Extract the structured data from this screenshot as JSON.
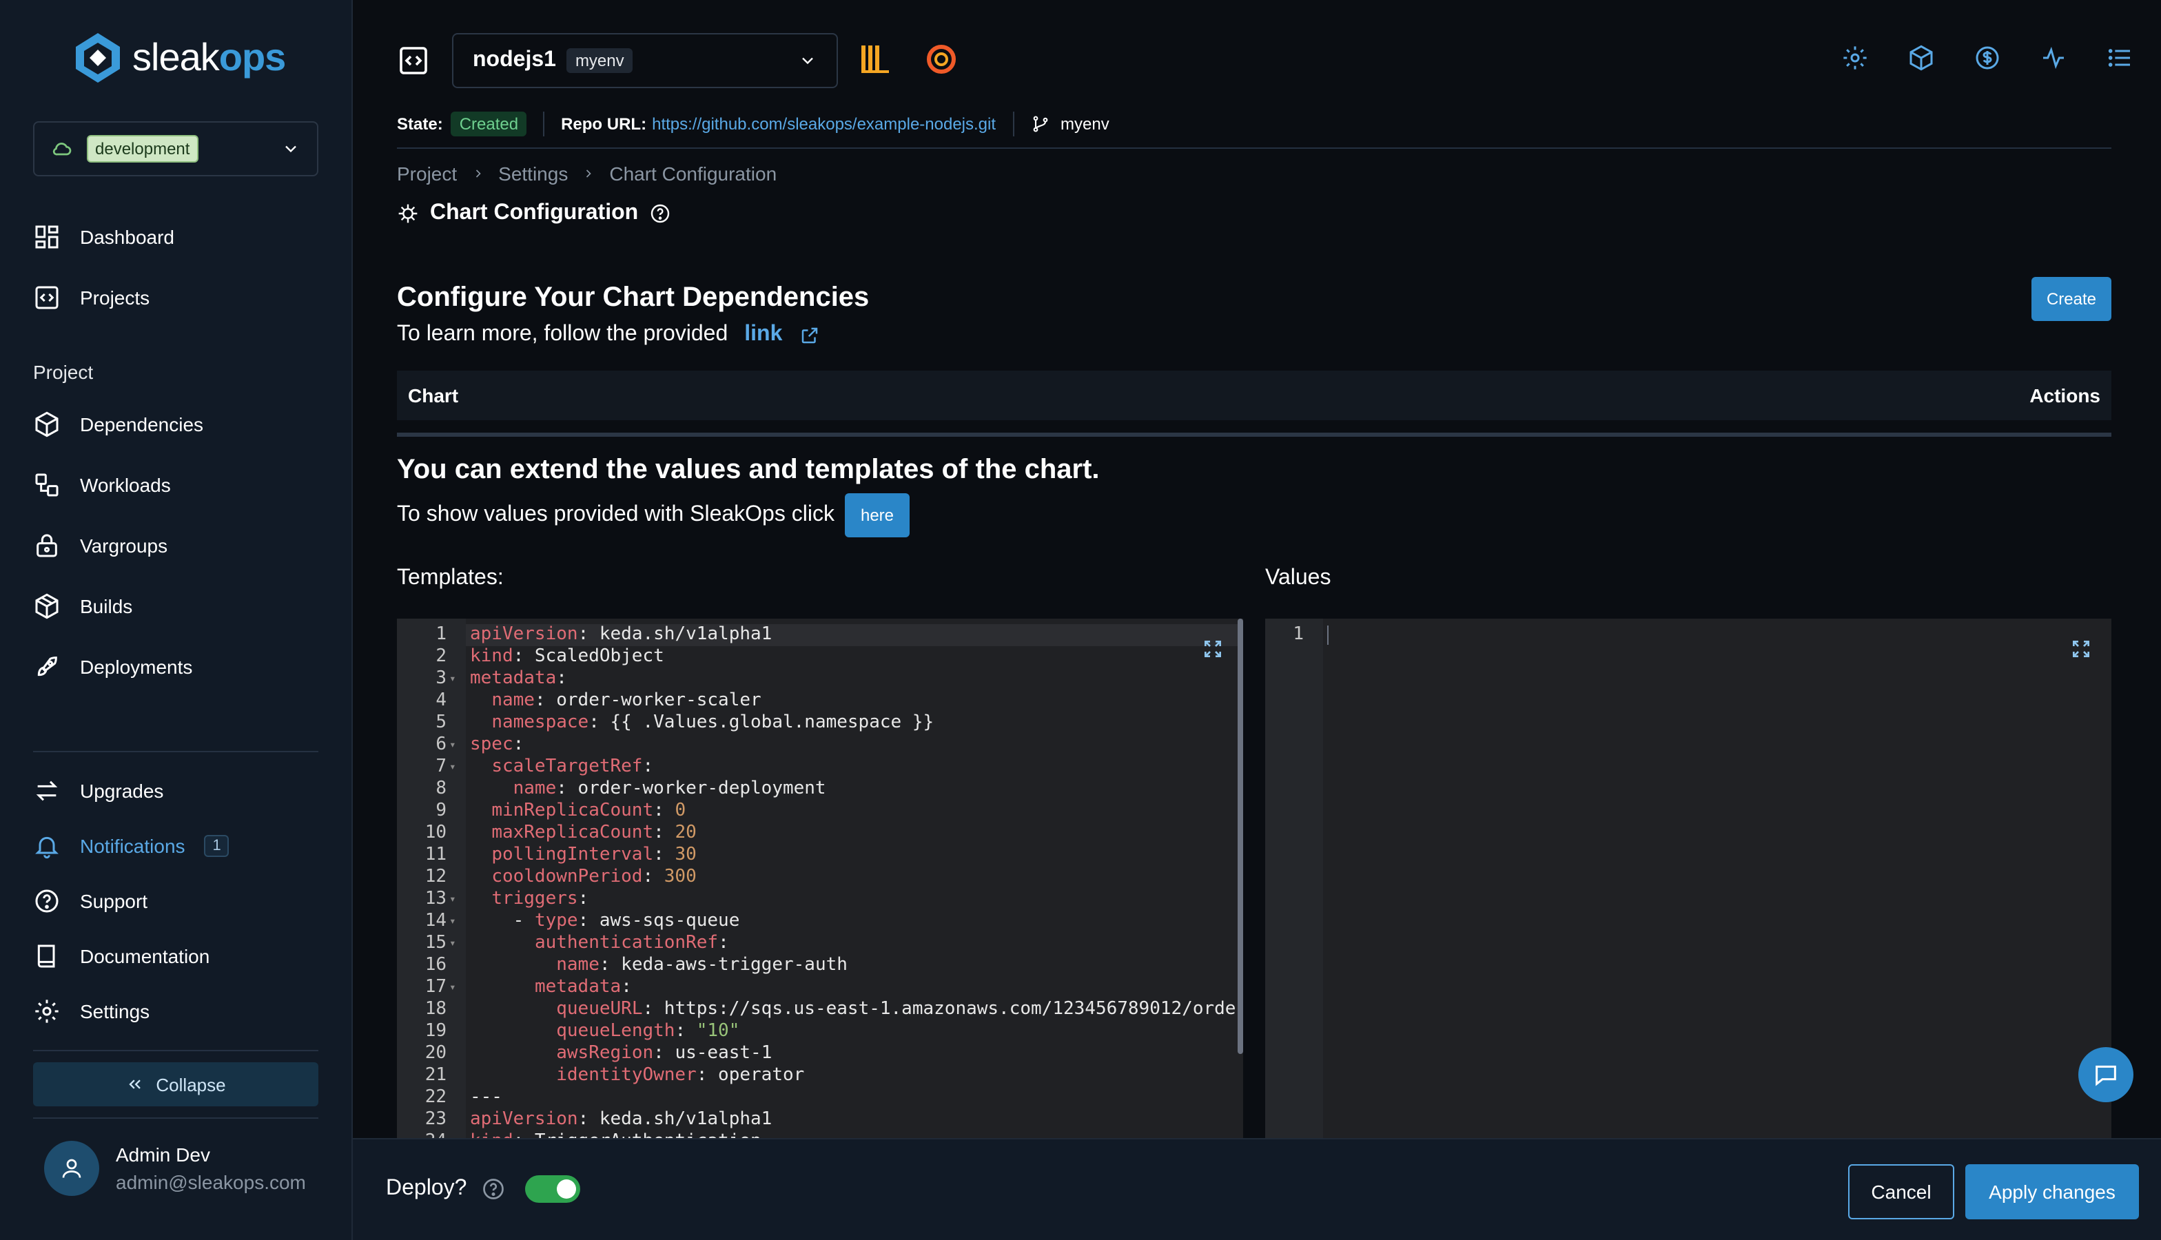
{
  "app": {
    "logo_main": "sleak",
    "logo_accent": "ops"
  },
  "sidebar": {
    "environment": "development",
    "items": [
      {
        "label": "Dashboard"
      },
      {
        "label": "Projects"
      }
    ],
    "project_section": "Project",
    "project_items": [
      {
        "label": "Dependencies"
      },
      {
        "label": "Workloads"
      },
      {
        "label": "Vargroups"
      },
      {
        "label": "Builds"
      },
      {
        "label": "Deployments"
      }
    ],
    "bottom_items": [
      {
        "label": "Upgrades"
      },
      {
        "label": "Notifications",
        "count": "1"
      },
      {
        "label": "Support"
      },
      {
        "label": "Documentation"
      },
      {
        "label": "Settings"
      }
    ],
    "collapse_label": "Collapse",
    "user": {
      "name": "Admin Dev",
      "email": "admin@sleakops.com"
    }
  },
  "header": {
    "project_name": "nodejs1",
    "project_env": "myenv",
    "state_label": "State:",
    "state_value": "Created",
    "repo_label": "Repo URL:",
    "repo_url": "https://github.com/sleakops/example-nodejs.git",
    "branch": "myenv"
  },
  "breadcrumb": [
    "Project",
    "Settings",
    "Chart Configuration"
  ],
  "page_title": "Chart Configuration",
  "dependencies": {
    "title": "Configure Your Chart Dependencies",
    "subtitle": "To learn more, follow the provided",
    "link_text": "link",
    "create_label": "Create",
    "table_columns": [
      "Chart",
      "Actions"
    ]
  },
  "extend": {
    "title": "You can extend the values and templates of the chart.",
    "subtitle": "To show values provided with SleakOps click",
    "here_label": "here"
  },
  "templates_label": "Templates:",
  "values_label": "Values",
  "templates_code": [
    {
      "n": "1",
      "fold": false,
      "tokens": [
        [
          "k",
          "apiVersion"
        ],
        [
          "p",
          ": keda.sh/v1alpha1"
        ]
      ]
    },
    {
      "n": "2",
      "fold": false,
      "tokens": [
        [
          "k",
          "kind"
        ],
        [
          "p",
          ": ScaledObject"
        ]
      ]
    },
    {
      "n": "3",
      "fold": true,
      "tokens": [
        [
          "k",
          "metadata"
        ],
        [
          "p",
          ":"
        ]
      ]
    },
    {
      "n": "4",
      "fold": false,
      "tokens": [
        [
          "p",
          "  "
        ],
        [
          "k",
          "name"
        ],
        [
          "p",
          ": order-worker-scaler"
        ]
      ]
    },
    {
      "n": "5",
      "fold": false,
      "tokens": [
        [
          "p",
          "  "
        ],
        [
          "k",
          "namespace"
        ],
        [
          "p",
          ": {{ .Values.global.namespace }}"
        ]
      ]
    },
    {
      "n": "6",
      "fold": true,
      "tokens": [
        [
          "k",
          "spec"
        ],
        [
          "p",
          ":"
        ]
      ]
    },
    {
      "n": "7",
      "fold": true,
      "tokens": [
        [
          "p",
          "  "
        ],
        [
          "k",
          "scaleTargetRef"
        ],
        [
          "p",
          ":"
        ]
      ]
    },
    {
      "n": "8",
      "fold": false,
      "tokens": [
        [
          "p",
          "    "
        ],
        [
          "k",
          "name"
        ],
        [
          "p",
          ": order-worker-deployment"
        ]
      ]
    },
    {
      "n": "9",
      "fold": false,
      "tokens": [
        [
          "p",
          "  "
        ],
        [
          "k",
          "minReplicaCount"
        ],
        [
          "p",
          ": "
        ],
        [
          "n",
          "0"
        ]
      ]
    },
    {
      "n": "10",
      "fold": false,
      "tokens": [
        [
          "p",
          "  "
        ],
        [
          "k",
          "maxReplicaCount"
        ],
        [
          "p",
          ": "
        ],
        [
          "n",
          "20"
        ]
      ]
    },
    {
      "n": "11",
      "fold": false,
      "tokens": [
        [
          "p",
          "  "
        ],
        [
          "k",
          "pollingInterval"
        ],
        [
          "p",
          ": "
        ],
        [
          "n",
          "30"
        ]
      ]
    },
    {
      "n": "12",
      "fold": false,
      "tokens": [
        [
          "p",
          "  "
        ],
        [
          "k",
          "cooldownPeriod"
        ],
        [
          "p",
          ": "
        ],
        [
          "n",
          "300"
        ]
      ]
    },
    {
      "n": "13",
      "fold": true,
      "tokens": [
        [
          "p",
          "  "
        ],
        [
          "k",
          "triggers"
        ],
        [
          "p",
          ":"
        ]
      ]
    },
    {
      "n": "14",
      "fold": true,
      "tokens": [
        [
          "p",
          "    - "
        ],
        [
          "k",
          "type"
        ],
        [
          "p",
          ": aws-sqs-queue"
        ]
      ]
    },
    {
      "n": "15",
      "fold": true,
      "tokens": [
        [
          "p",
          "      "
        ],
        [
          "k",
          "authenticationRef"
        ],
        [
          "p",
          ":"
        ]
      ]
    },
    {
      "n": "16",
      "fold": false,
      "tokens": [
        [
          "p",
          "        "
        ],
        [
          "k",
          "name"
        ],
        [
          "p",
          ": keda-aws-trigger-auth"
        ]
      ]
    },
    {
      "n": "17",
      "fold": true,
      "tokens": [
        [
          "p",
          "      "
        ],
        [
          "k",
          "metadata"
        ],
        [
          "p",
          ":"
        ]
      ]
    },
    {
      "n": "18",
      "fold": false,
      "tokens": [
        [
          "p",
          "        "
        ],
        [
          "k",
          "queueURL"
        ],
        [
          "p",
          ": https://sqs.us-east-1.amazonaws.com/123456789012/orde"
        ]
      ]
    },
    {
      "n": "19",
      "fold": false,
      "tokens": [
        [
          "p",
          "        "
        ],
        [
          "k",
          "queueLength"
        ],
        [
          "p",
          ": "
        ],
        [
          "s",
          "\"10\""
        ]
      ]
    },
    {
      "n": "20",
      "fold": false,
      "tokens": [
        [
          "p",
          "        "
        ],
        [
          "k",
          "awsRegion"
        ],
        [
          "p",
          ": us-east-1"
        ]
      ]
    },
    {
      "n": "21",
      "fold": false,
      "tokens": [
        [
          "p",
          "        "
        ],
        [
          "k",
          "identityOwner"
        ],
        [
          "p",
          ": operator"
        ]
      ]
    },
    {
      "n": "22",
      "fold": false,
      "tokens": [
        [
          "p",
          "---"
        ]
      ]
    },
    {
      "n": "23",
      "fold": false,
      "tokens": [
        [
          "k",
          "apiVersion"
        ],
        [
          "p",
          ": keda.sh/v1alpha1"
        ]
      ]
    },
    {
      "n": "24",
      "fold": false,
      "tokens": [
        [
          "k",
          "kind"
        ],
        [
          "p",
          ": TriggerAuthentication"
        ]
      ]
    }
  ],
  "values_code": [
    {
      "n": "1"
    }
  ],
  "footer": {
    "deploy_label": "Deploy?",
    "deploy_on": true,
    "cancel_label": "Cancel",
    "apply_label": "Apply changes"
  },
  "colors": {
    "accent": "#2a86c8",
    "success": "#2ea44f",
    "link": "#5aa9e6"
  }
}
